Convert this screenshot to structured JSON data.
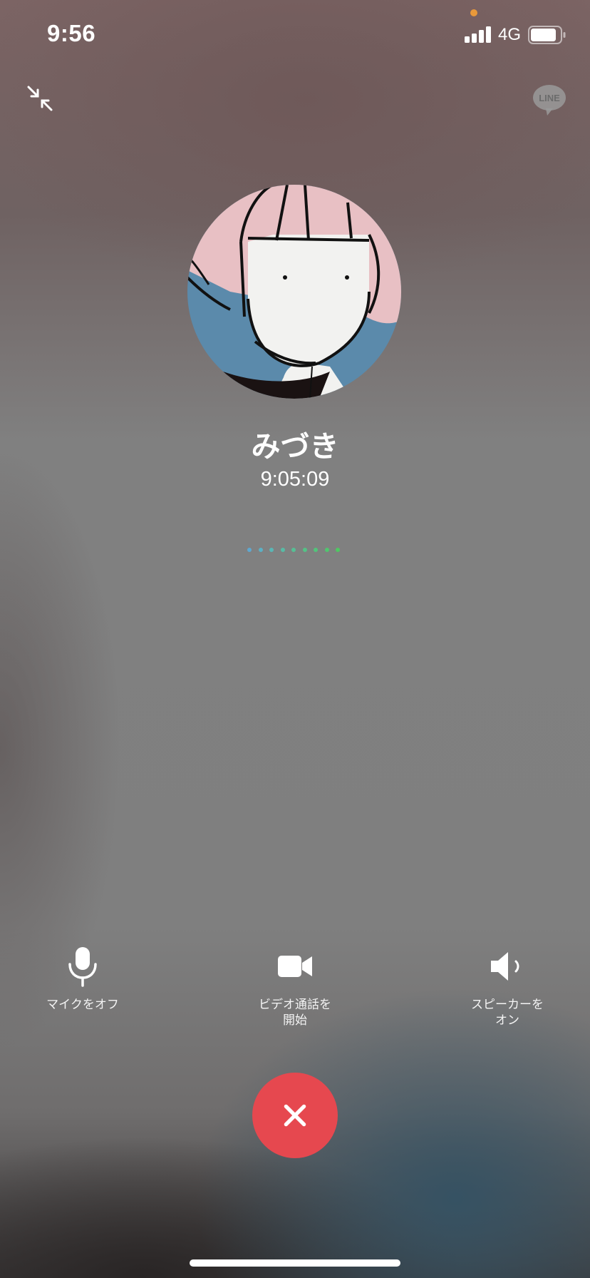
{
  "status_bar": {
    "time": "9:56",
    "network": "4G",
    "icons": [
      "signal-icon",
      "battery-icon"
    ]
  },
  "header": {
    "minimize_icon": "minimize-arrows-icon",
    "brand_logo": "LINE"
  },
  "caller": {
    "name": "みづき",
    "duration": "9:05:09"
  },
  "audio_indicator": {
    "colors": [
      "#5fa8d0",
      "#5cb0c4",
      "#5ab6b5",
      "#58bba5",
      "#56bf95",
      "#54c286",
      "#52c47a",
      "#50c66e",
      "#4ec862"
    ]
  },
  "controls": {
    "mic": {
      "label": "マイクをオフ",
      "icon": "microphone-icon"
    },
    "video": {
      "label_line1": "ビデオ通話を",
      "label_line2": "開始",
      "icon": "video-camera-icon"
    },
    "speaker": {
      "label_line1": "スピーカーを",
      "label_line2": "オン",
      "icon": "speaker-icon"
    }
  },
  "end_call": {
    "icon": "close-icon",
    "color": "#e6484f"
  }
}
